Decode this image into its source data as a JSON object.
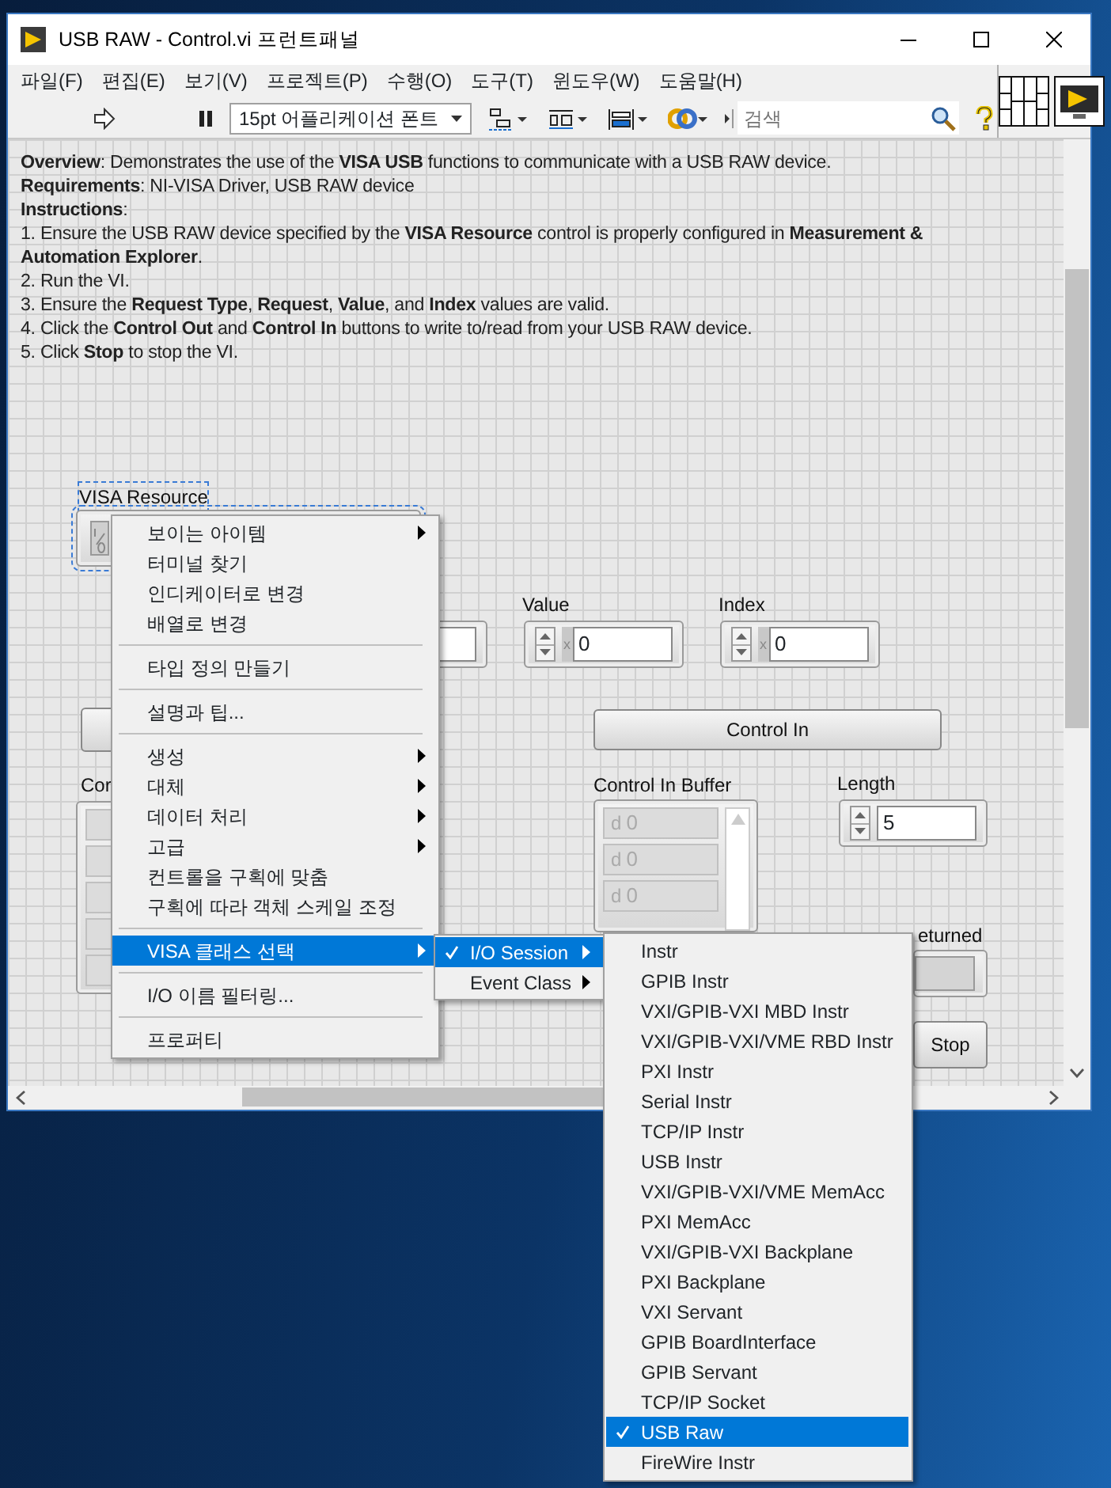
{
  "window": {
    "title": "USB RAW - Control.vi 프런트패널"
  },
  "menu_bar": [
    "파일(F)",
    "편집(E)",
    "보기(V)",
    "프로젝트(P)",
    "수행(O)",
    "도구(T)",
    "윈도우(W)",
    "도움말(H)"
  ],
  "toolbar": {
    "font": "15pt 어플리케이션 폰트",
    "search_placeholder": "검색"
  },
  "description": [
    "**Overview**: Demonstrates the use of the **VISA USB** functions to communicate with a USB RAW device.",
    "**Requirements**: NI-VISA Driver, USB RAW device",
    "**Instructions**:",
    "1. Ensure the USB RAW device specified by the **VISA Resource** control is properly configured in **Measurement & Automation Explorer**.",
    "2. Run the VI.",
    "3. Ensure the **Request Type**, **Request**, **Value**, and **Index** values are valid.",
    "4. Click the **Control Out** and **Control In** buttons to write to/read from your USB RAW device.",
    "5. Click **Stop** to stop the VI."
  ],
  "front_panel": [
    {
      "kind": "visa",
      "label": "VISA Resource",
      "selected": true
    },
    {
      "kind": "field"
    },
    {
      "kind": "button"
    },
    {
      "kind": "array",
      "label": "Cor"
    },
    {
      "kind": "numeric",
      "label": "Value",
      "radix": "x",
      "value": "0"
    },
    {
      "kind": "numeric",
      "label": "Index",
      "radix": "x",
      "value": "0"
    },
    {
      "kind": "button",
      "label": "Control In"
    },
    {
      "kind": "array",
      "label": "Control In Buffer",
      "cells": [
        {
          "radix": "d",
          "value": "0"
        },
        {
          "radix": "d",
          "value": "0"
        },
        {
          "radix": "d",
          "value": "0"
        }
      ]
    },
    {
      "kind": "numeric",
      "label": "Length",
      "value": "5"
    },
    {
      "kind": "indicator",
      "label": "eturned"
    },
    {
      "kind": "button",
      "label": "Stop"
    }
  ],
  "context_menu": [
    {
      "kind": "item",
      "label": "보이는 아이템",
      "has_submenu": true,
      "selected": false
    },
    {
      "kind": "item",
      "label": "터미널 찾기",
      "has_submenu": false,
      "selected": false
    },
    {
      "kind": "item",
      "label": "인디케이터로 변경",
      "has_submenu": false,
      "selected": false
    },
    {
      "kind": "item",
      "label": "배열로 변경",
      "has_submenu": false,
      "selected": false
    },
    {
      "kind": "separator"
    },
    {
      "kind": "item",
      "label": "타입 정의 만들기",
      "has_submenu": false,
      "selected": false
    },
    {
      "kind": "separator"
    },
    {
      "kind": "item",
      "label": "설명과 팁...",
      "has_submenu": false,
      "selected": false
    },
    {
      "kind": "separator"
    },
    {
      "kind": "item",
      "label": "생성",
      "has_submenu": true,
      "selected": false
    },
    {
      "kind": "item",
      "label": "대체",
      "has_submenu": true,
      "selected": false
    },
    {
      "kind": "item",
      "label": "데이터 처리",
      "has_submenu": true,
      "selected": false
    },
    {
      "kind": "item",
      "label": "고급",
      "has_submenu": true,
      "selected": false
    },
    {
      "kind": "item",
      "label": "컨트롤을 구획에 맞춤",
      "has_submenu": false,
      "selected": false
    },
    {
      "kind": "item",
      "label": "구획에 따라 객체 스케일 조정",
      "has_submenu": false,
      "selected": false
    },
    {
      "kind": "separator"
    },
    {
      "kind": "item",
      "label": "VISA 클래스 선택",
      "has_submenu": true,
      "selected": true
    },
    {
      "kind": "separator"
    },
    {
      "kind": "item",
      "label": "I/O 이름 필터링...",
      "has_submenu": false,
      "selected": false
    },
    {
      "kind": "separator"
    },
    {
      "kind": "item",
      "label": "프로퍼티",
      "has_submenu": false,
      "selected": false
    }
  ],
  "class_submenu": [
    {
      "label": "I/O Session",
      "checked": true,
      "selected": true,
      "has_submenu": true
    },
    {
      "label": "Event Class",
      "checked": false,
      "selected": false,
      "has_submenu": true
    }
  ],
  "session_submenu": [
    {
      "label": "Instr",
      "checked": false,
      "selected": false
    },
    {
      "label": "GPIB Instr",
      "checked": false,
      "selected": false
    },
    {
      "label": "VXI/GPIB-VXI MBD Instr",
      "checked": false,
      "selected": false
    },
    {
      "label": "VXI/GPIB-VXI/VME RBD Instr",
      "checked": false,
      "selected": false
    },
    {
      "label": "PXI Instr",
      "checked": false,
      "selected": false
    },
    {
      "label": "Serial Instr",
      "checked": false,
      "selected": false
    },
    {
      "label": "TCP/IP Instr",
      "checked": false,
      "selected": false
    },
    {
      "label": "USB Instr",
      "checked": false,
      "selected": false
    },
    {
      "label": "VXI/GPIB-VXI/VME MemAcc",
      "checked": false,
      "selected": false
    },
    {
      "label": "PXI MemAcc",
      "checked": false,
      "selected": false
    },
    {
      "label": "VXI/GPIB-VXI Backplane",
      "checked": false,
      "selected": false
    },
    {
      "label": "PXI Backplane",
      "checked": false,
      "selected": false
    },
    {
      "label": "VXI Servant",
      "checked": false,
      "selected": false
    },
    {
      "label": "GPIB BoardInterface",
      "checked": false,
      "selected": false
    },
    {
      "label": "GPIB Servant",
      "checked": false,
      "selected": false
    },
    {
      "label": "TCP/IP Socket",
      "checked": false,
      "selected": false
    },
    {
      "label": "USB Raw",
      "checked": true,
      "selected": true
    },
    {
      "label": "FireWire Instr",
      "checked": false,
      "selected": false
    }
  ]
}
